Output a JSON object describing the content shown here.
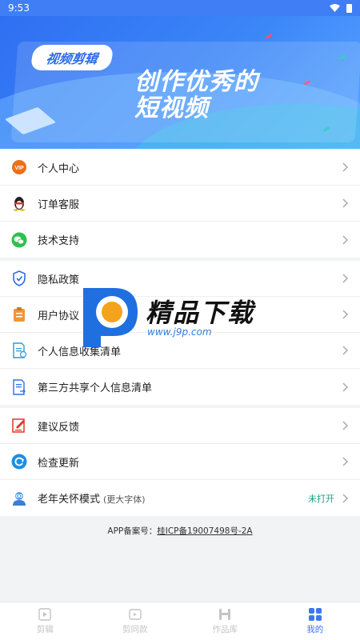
{
  "status_bar": {
    "time": "9:53"
  },
  "banner": {
    "tag": "视频剪辑",
    "headline_line1": "创作优秀的",
    "headline_line2": "短视频"
  },
  "sections": [
    [
      {
        "label": "个人中心",
        "icon": "vip-icon"
      },
      {
        "label": "订单客服",
        "icon": "qq-penguin-icon"
      },
      {
        "label": "技术支持",
        "icon": "wechat-icon"
      }
    ],
    [
      {
        "label": "隐私政策",
        "icon": "shield-icon"
      },
      {
        "label": "用户协议",
        "icon": "clipboard-icon"
      },
      {
        "label": "个人信息收集清单",
        "icon": "document-list-icon"
      },
      {
        "label": "第三方共享个人信息清单",
        "icon": "share-document-icon"
      }
    ],
    [
      {
        "label": "建议反馈",
        "icon": "feedback-icon"
      },
      {
        "label": "检查更新",
        "icon": "refresh-icon"
      },
      {
        "label": "老年关怀模式",
        "sub": "(更大字体)",
        "status": "未打开",
        "icon": "elderly-icon"
      }
    ]
  ],
  "footer": {
    "prefix": "APP备案号：",
    "code": "桂ICP备19007498号-2A"
  },
  "watermark": {
    "title": "精品下载",
    "url": "www.j9p.com"
  },
  "tabs": [
    {
      "label": "剪辑",
      "icon": "video-clip-icon",
      "active": false
    },
    {
      "label": "剪同款",
      "icon": "template-icon",
      "active": false
    },
    {
      "label": "作品库",
      "icon": "library-icon",
      "active": false
    },
    {
      "label": "我的",
      "icon": "grid-icon",
      "active": true
    }
  ],
  "colors": {
    "accent": "#3a78f2",
    "status_green": "#16a085",
    "banner_blue": "#3f7ef5"
  }
}
